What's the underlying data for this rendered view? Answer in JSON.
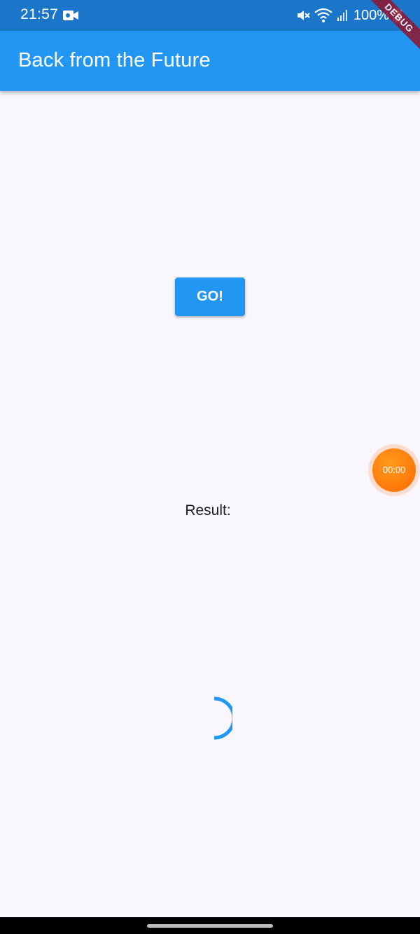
{
  "status_bar": {
    "time": "21:57",
    "battery": "100%",
    "icons": [
      "video-camera-icon",
      "mute-icon",
      "wifi-icon",
      "signal-icon",
      "battery-icon"
    ]
  },
  "app_bar": {
    "title": "Back from the Future",
    "debug_banner": "DEBUG"
  },
  "main": {
    "go_button": "GO!",
    "result_label": "Result:"
  },
  "timer_bubble": {
    "time": "00:00"
  },
  "colors": {
    "primary": "#2196f3",
    "status_bar": "#1b76c9",
    "timer": "#ff7a10",
    "debug": "#8b1c3a"
  }
}
